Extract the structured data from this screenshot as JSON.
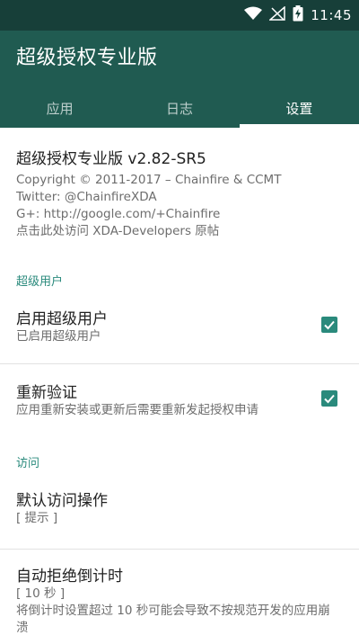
{
  "status_bar": {
    "time": "11:45",
    "icons": [
      "wifi-icon",
      "signal-off-icon",
      "battery-charging-icon"
    ]
  },
  "app_bar": {
    "title": "超级授权专业版"
  },
  "tabs": [
    {
      "label": "应用",
      "active": false
    },
    {
      "label": "日志",
      "active": false
    },
    {
      "label": "设置",
      "active": true
    }
  ],
  "about": {
    "headline": "超级授权专业版 v2.82-SR5",
    "copyright": "Copyright © 2011-2017 – Chainfire & CCMT",
    "twitter": "Twitter: @ChainfireXDA",
    "gplus": "G+: http://google.com/+Chainfire",
    "xda_link": "点击此处访问 XDA-Developers 原帖"
  },
  "sections": {
    "superuser": {
      "header": "超级用户",
      "enable_su": {
        "title": "启用超级用户",
        "summary": "已启用超级用户",
        "checked": true
      },
      "reauthenticate": {
        "title": "重新验证",
        "summary": "应用重新安装或更新后需要重新发起授权申请",
        "checked": true
      }
    },
    "access": {
      "header": "访问",
      "default_action": {
        "title": "默认访问操作",
        "value": "[ 提示 ]"
      },
      "auto_deny": {
        "title": "自动拒绝倒计时",
        "value": "[ 10 秒 ]",
        "note": "将倒计时设置超过 10 秒可能会导致不按规范开发的应用崩溃"
      }
    }
  },
  "colors": {
    "status_bar": "#173f39",
    "app_bar": "#205b51",
    "accent": "#2a8a7c"
  }
}
